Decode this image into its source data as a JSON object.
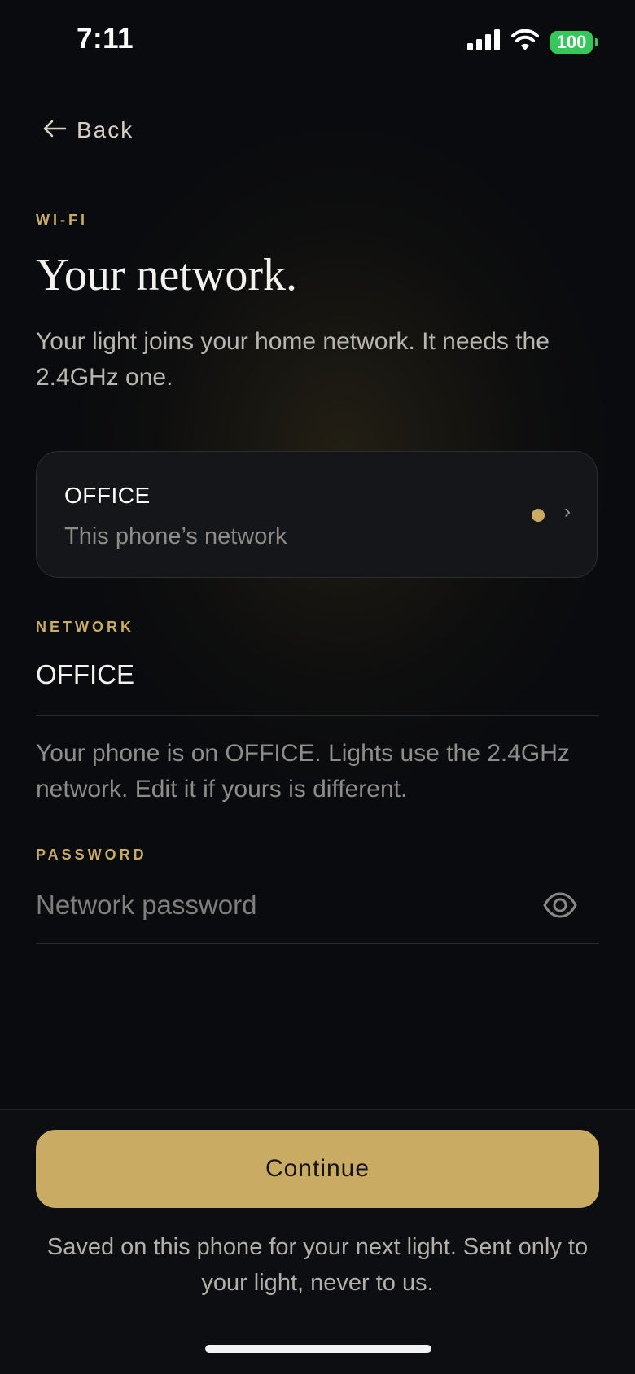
{
  "status_bar": {
    "time": "7:11",
    "battery": "100",
    "icons": [
      "cellular-signal-icon",
      "wifi-icon",
      "battery-icon"
    ]
  },
  "nav": {
    "back_label": "Back",
    "back_icon": "arrow-left-icon"
  },
  "header": {
    "eyebrow": "WI-FI",
    "title": "Your network.",
    "subtitle": "Your light joins your home network. It needs the 2.4GHz one."
  },
  "network_card": {
    "name": "OFFICE",
    "description": "This phone’s network",
    "chevron": "›"
  },
  "network_field": {
    "label": "NETWORK",
    "value": "OFFICE",
    "helper": "Your phone is on OFFICE. Lights use the 2.4GHz network. Edit it if yours is different."
  },
  "password_field": {
    "label": "PASSWORD",
    "placeholder": "Network password",
    "value": "",
    "toggle_icon": "eye-icon"
  },
  "footer": {
    "continue_label": "Continue",
    "note": "Saved on this phone for your next light. Sent only to your light, never to us."
  },
  "colors": {
    "accent": "#c9ab63",
    "background": "#0a0b0e",
    "card": "#15161a",
    "battery": "#34c759"
  }
}
